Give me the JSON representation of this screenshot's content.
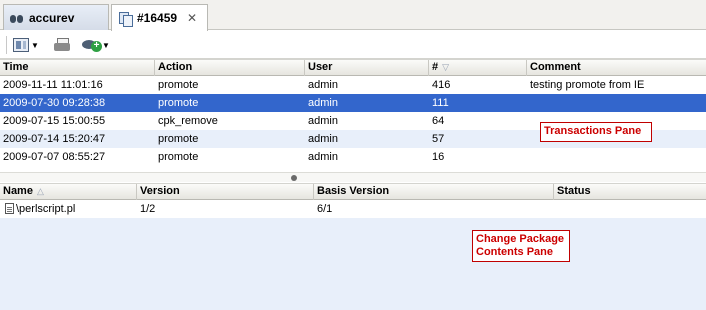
{
  "tabs": [
    {
      "label": "accurev",
      "icon": "binoculars-icon",
      "active": false
    },
    {
      "label": "#16459",
      "icon": "copy-icon",
      "active": true,
      "close": "✕"
    }
  ],
  "toolbar": {
    "buttons": [
      {
        "icon": "layout-icon",
        "has_dropdown": true
      },
      {
        "icon": "printer-icon",
        "has_dropdown": false
      },
      {
        "icon": "view-add-icon",
        "has_dropdown": true
      }
    ]
  },
  "transactions": {
    "columns": [
      "Time",
      "Action",
      "User",
      "#",
      "Comment"
    ],
    "sort_column": "#",
    "rows": [
      {
        "time": "2009-11-11 11:01:16",
        "action": "promote",
        "user": "admin",
        "num": "416",
        "comment": "testing promote from IE"
      },
      {
        "time": "2009-07-30 09:28:38",
        "action": "promote",
        "user": "admin",
        "num": "111",
        "comment": "",
        "selected": true
      },
      {
        "time": "2009-07-15 15:00:55",
        "action": "cpk_remove",
        "user": "admin",
        "num": "64",
        "comment": ""
      },
      {
        "time": "2009-07-14 15:20:47",
        "action": "promote",
        "user": "admin",
        "num": "57",
        "comment": ""
      },
      {
        "time": "2009-07-07 08:55:27",
        "action": "promote",
        "user": "admin",
        "num": "16",
        "comment": ""
      }
    ],
    "callout": "Transactions Pane"
  },
  "package": {
    "columns": [
      "Name",
      "Version",
      "Basis Version",
      "Status"
    ],
    "sort_column": "Name",
    "rows": [
      {
        "name": "\\perlscript.pl",
        "version": "1/2",
        "basis": "6/1",
        "status": ""
      }
    ],
    "callout_line1": "Change Package",
    "callout_line2": "Contents Pane"
  },
  "colors": {
    "selection": "#3366cc",
    "alt_row": "#e8effa",
    "callout_red": "#cc0000"
  }
}
